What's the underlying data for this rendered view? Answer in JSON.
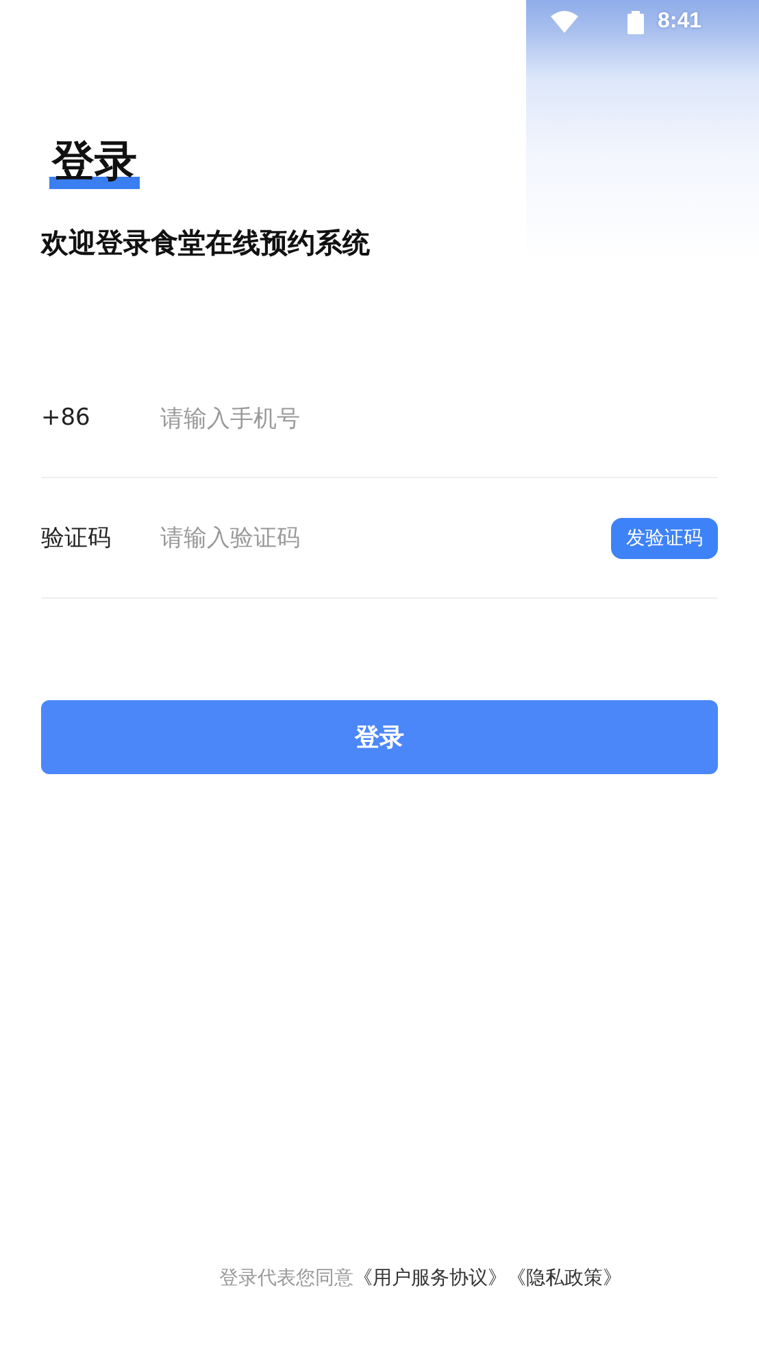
{
  "status_bar": {
    "time": "8:41"
  },
  "title": "登录",
  "subtitle": "欢迎登录食堂在线预约系统",
  "fields": [
    {
      "label": "+86",
      "placeholder": "请输入手机号",
      "kind": "phone"
    },
    {
      "label": "验证码",
      "placeholder": "请输入验证码",
      "kind": "code",
      "action": "发验证码"
    }
  ],
  "login_button": "登录",
  "agreement": {
    "prefix": "登录代表您同意",
    "links": [
      "《用户服务协议》",
      "《隐私政策》"
    ]
  }
}
